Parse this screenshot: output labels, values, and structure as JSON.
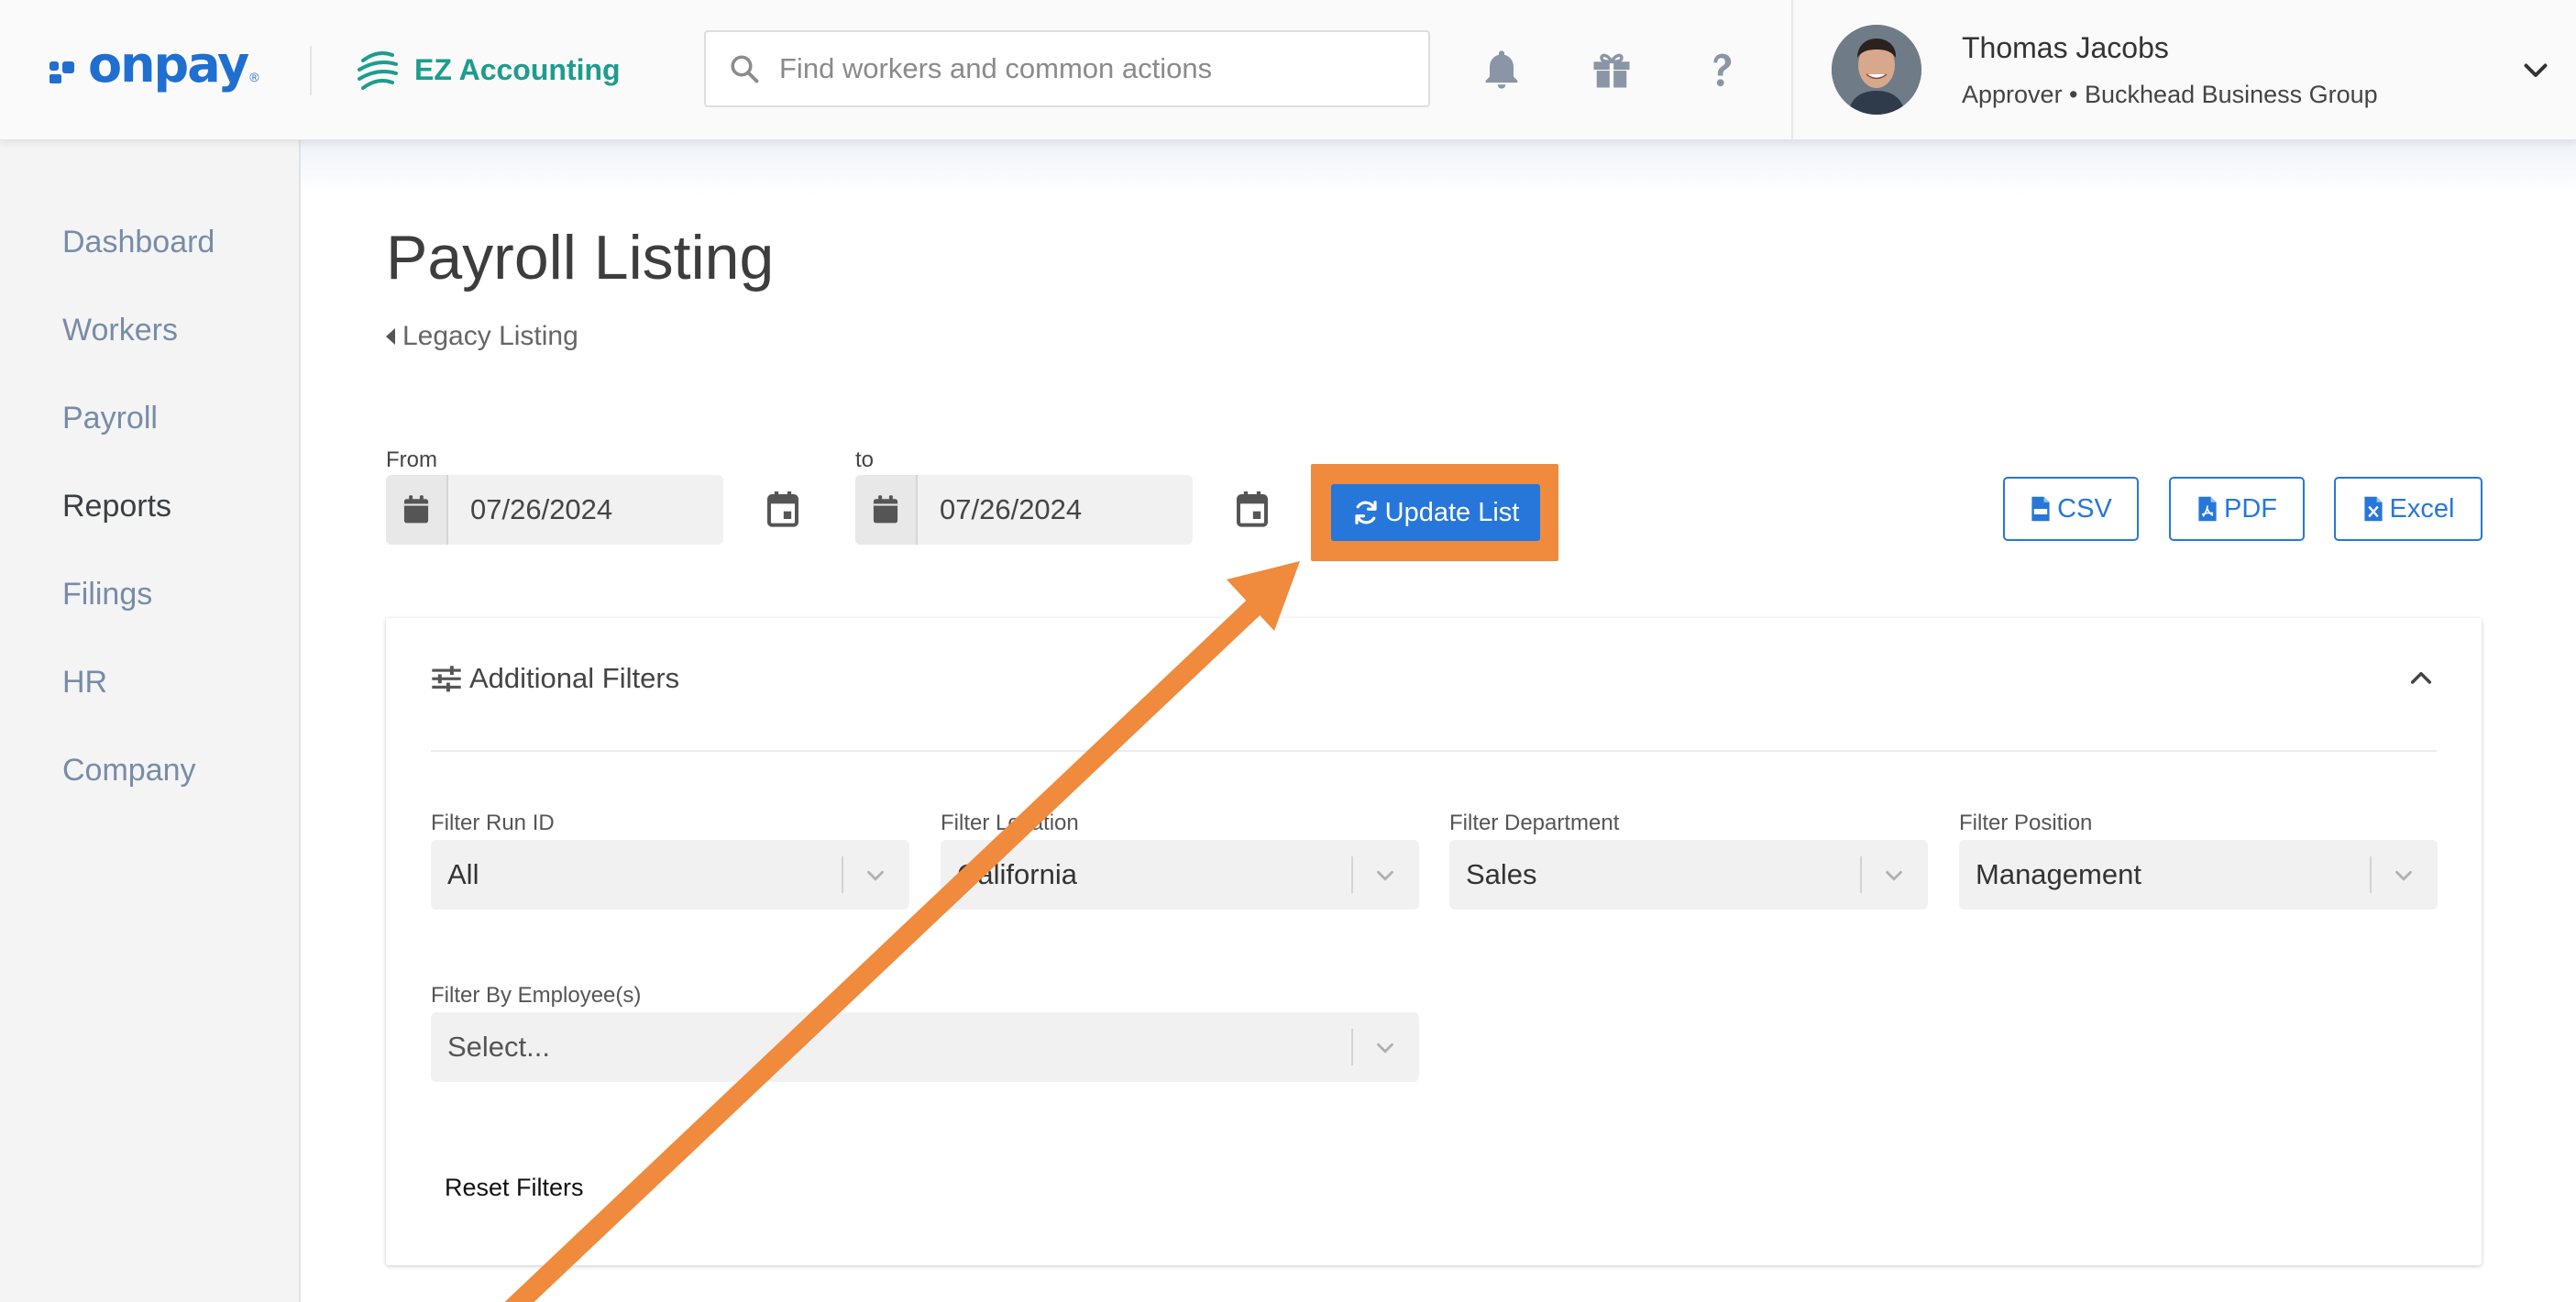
{
  "header": {
    "brand": "onpay",
    "brand_mark": "®",
    "partner": "EZ Accounting",
    "search_placeholder": "Find workers and common actions",
    "icons": [
      "bell-icon",
      "gift-icon",
      "help-icon"
    ],
    "user": {
      "name": "Thomas Jacobs",
      "role": "Approver • Buckhead Business Group"
    }
  },
  "sidebar": {
    "items": [
      {
        "label": "Dashboard"
      },
      {
        "label": "Workers"
      },
      {
        "label": "Payroll"
      },
      {
        "label": "Reports",
        "active": true
      },
      {
        "label": "Filings"
      },
      {
        "label": "HR"
      },
      {
        "label": "Company"
      }
    ]
  },
  "page": {
    "title": "Payroll Listing",
    "legacy_link": "Legacy Listing",
    "from_label": "From",
    "from_value": "07/26/2024",
    "to_label": "to",
    "to_value": "07/26/2024",
    "update_button": "Update List",
    "exports": {
      "csv": "CSV",
      "pdf": "PDF",
      "excel": "Excel"
    }
  },
  "filters": {
    "title": "Additional Filters",
    "run_id": {
      "label": "Filter Run ID",
      "value": "All"
    },
    "location": {
      "label": "Filter Location",
      "value": "California"
    },
    "department": {
      "label": "Filter Department",
      "value": "Sales"
    },
    "position": {
      "label": "Filter Position",
      "value": "Management"
    },
    "employees": {
      "label": "Filter By Employee(s)",
      "placeholder": "Select..."
    },
    "reset": "Reset Filters"
  },
  "colors": {
    "brand_blue": "#1f6fd1",
    "partner_green": "#1e9c8e",
    "button_blue": "#2677d9",
    "highlight_orange": "#f08a3c"
  }
}
